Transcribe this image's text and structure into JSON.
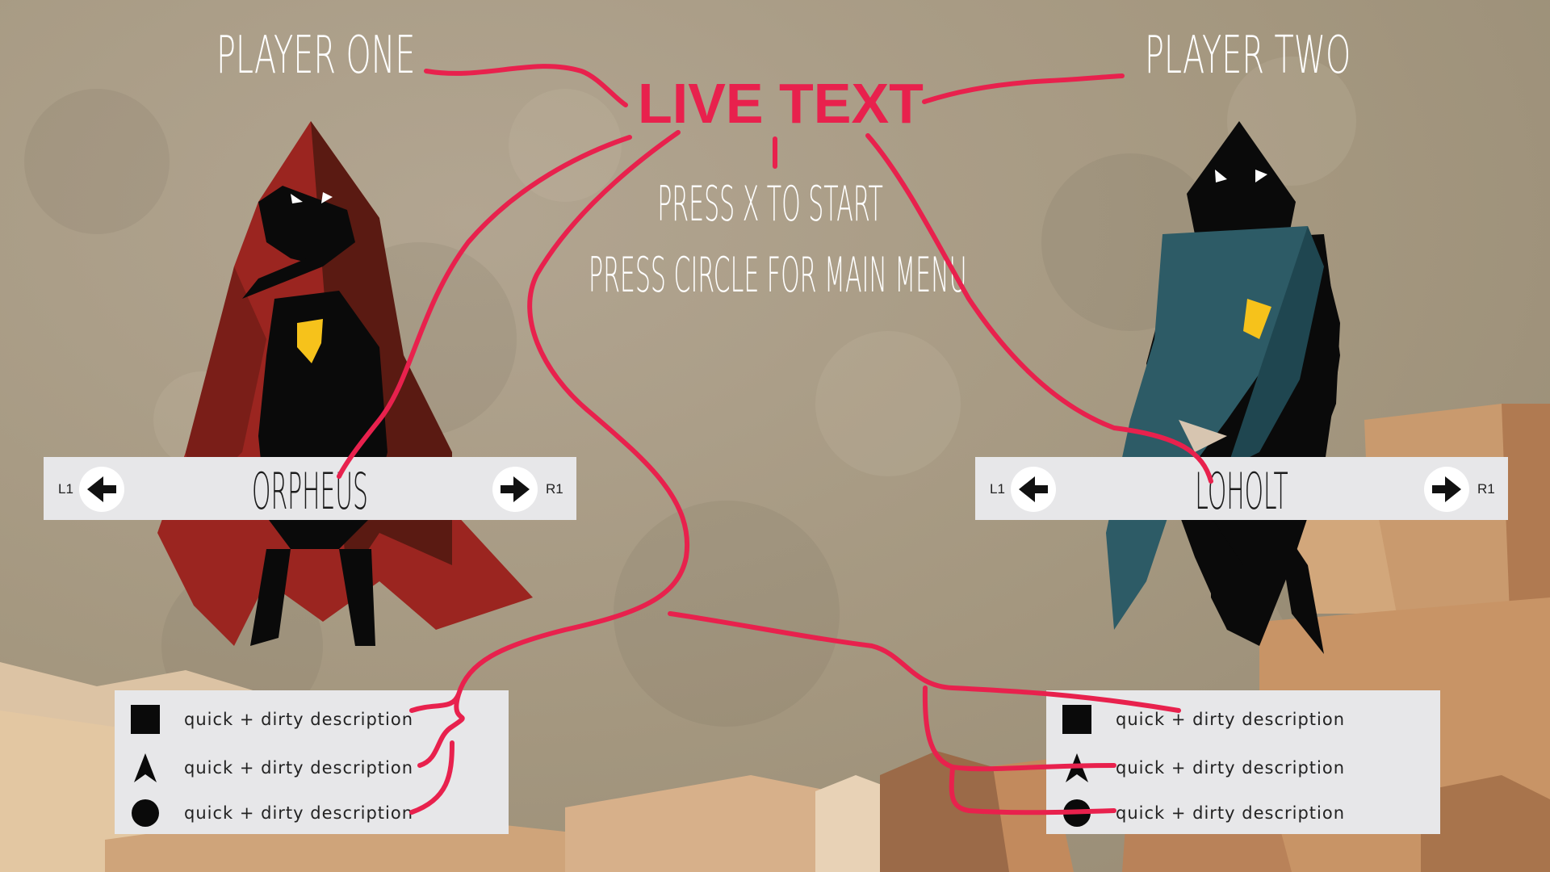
{
  "player_one": {
    "heading": "PLAYER ONE",
    "character_name": "ORPHEUS",
    "left_bumper": "L1",
    "right_bumper": "R1"
  },
  "player_two": {
    "heading": "PLAYER TWO",
    "character_name": "LOHOLT",
    "left_bumper": "L1",
    "right_bumper": "R1"
  },
  "annotation": "LIVE TEXT",
  "prompts": {
    "start": "PRESS X TO START",
    "menu": "PRESS CIRCLE FOR MAIN MENU"
  },
  "descriptions": {
    "player_one": [
      {
        "icon": "square-icon",
        "text": "quick + dirty description"
      },
      {
        "icon": "triangle-icon",
        "text": "quick + dirty description"
      },
      {
        "icon": "circle-icon",
        "text": "quick + dirty description"
      }
    ],
    "player_two": [
      {
        "icon": "square-icon",
        "text": "quick + dirty description"
      },
      {
        "icon": "triangle-icon",
        "text": "quick + dirty description"
      },
      {
        "icon": "circle-icon",
        "text": "quick + dirty description"
      }
    ]
  },
  "colors": {
    "background": "#a79a86",
    "annotation": "#e8214d",
    "panel": "#e7e7e9",
    "cloak_red": "#9b2520",
    "cloak_teal": "#2d5b66",
    "emblem": "#f6c21b",
    "terrain": "#c99a6e"
  }
}
